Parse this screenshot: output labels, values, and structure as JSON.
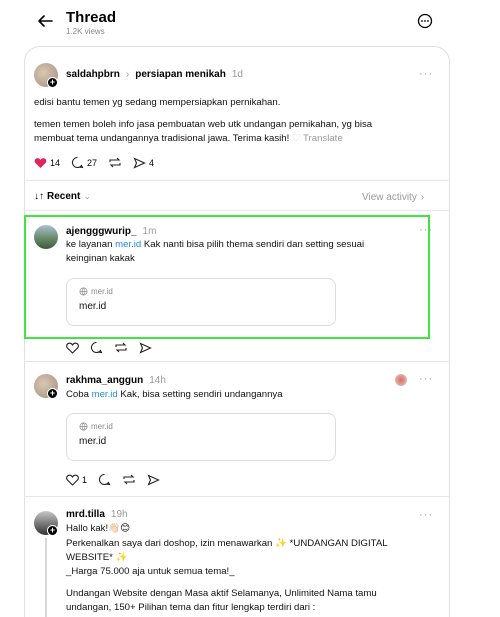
{
  "header": {
    "title": "Thread",
    "views": "1.2K views"
  },
  "post": {
    "username": "saldahpbrn",
    "separator": "›",
    "topic": "persiapan menikah",
    "time": "1d",
    "line1": "edisi bantu temen yg sedang mempersiapkan pernikahan.",
    "line2": "temen temen boleh info jasa pembuatan web utk undangan pernikahan, yg bisa",
    "line3": "membuat tema undangannya tradisional jawa. Terima kasih!",
    "translate": "Translate",
    "likes": "14",
    "replies": "27",
    "shares": "4"
  },
  "sort": {
    "label": "Recent",
    "view_activity": "View activity"
  },
  "replies": [
    {
      "username": "ajengggwurip_",
      "time": "1m",
      "text_pre": "ke layanan ",
      "link": "mer.id",
      "text_post": " Kak nanti bisa pilih thema sendiri dan setting sesuai",
      "text_line2": "keinginan kakak",
      "preview_domain": "mer.id",
      "preview_title": "mer.id"
    },
    {
      "username": "rakhma_anggun",
      "time": "14h",
      "text_pre": "Coba ",
      "link": "mer.id",
      "text_post": " Kak, bisa setting sendiri undangannya",
      "preview_domain": "mer.id",
      "preview_title": "mer.id",
      "likes": "1"
    },
    {
      "username": "mrd.tilla",
      "time": "19h",
      "line1": "Hallo kak!👋🏻😊",
      "line2": "Perkenalkan saya dari doshop, izin menawarkan ✨ *UNDANGAN DIGITAL",
      "line3": "WEBSITE* ✨",
      "line4": "_Harga 75.000 aja untuk semua tema!_",
      "line5": "Undangan Website dengan Masa aktif Selamanya, Unlimited Nama tamu",
      "line6": "undangan, 150+ Pilihan tema dan fitur lengkap terdiri dari :"
    }
  ],
  "colors": {
    "link": "#1d8ce8",
    "heart": "#e0245e",
    "highlight": "#3ee63e"
  }
}
